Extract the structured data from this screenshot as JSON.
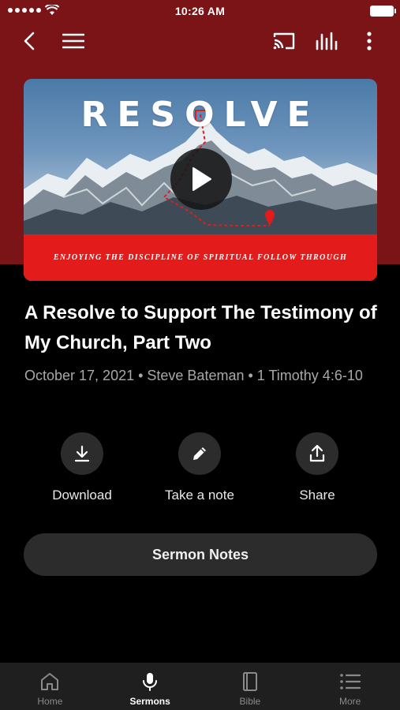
{
  "status_bar": {
    "time": "10:26 AM"
  },
  "toolbar": {
    "back_icon": "chevron-left-icon",
    "menu_icon": "hamburger-icon",
    "cast_icon": "cast-icon",
    "equalizer_icon": "equalizer-icon",
    "more_icon": "more-vertical-icon"
  },
  "artwork": {
    "title": "RESOLVE",
    "subtitle": "Enjoying the Discipline of Spiritual Follow Through",
    "accent_color": "#e41b1b"
  },
  "sermon": {
    "title": "A Resolve to Support The Testimony of My Church, Part Two",
    "meta": "October 17, 2021 • Steve Bateman • 1 Timothy 4:6-10"
  },
  "actions": [
    {
      "label": "Download",
      "icon": "download-icon"
    },
    {
      "label": "Take a note",
      "icon": "pencil-icon"
    },
    {
      "label": "Share",
      "icon": "share-icon"
    }
  ],
  "notes_button": {
    "label": "Sermon Notes"
  },
  "tabs": [
    {
      "label": "Home",
      "icon": "home-icon",
      "active": false
    },
    {
      "label": "Sermons",
      "icon": "microphone-icon",
      "active": true
    },
    {
      "label": "Bible",
      "icon": "book-icon",
      "active": false
    },
    {
      "label": "More",
      "icon": "list-icon",
      "active": false
    }
  ],
  "colors": {
    "header_red": "#7a1416",
    "background": "#000000",
    "control_gray": "#2c2c2c"
  }
}
